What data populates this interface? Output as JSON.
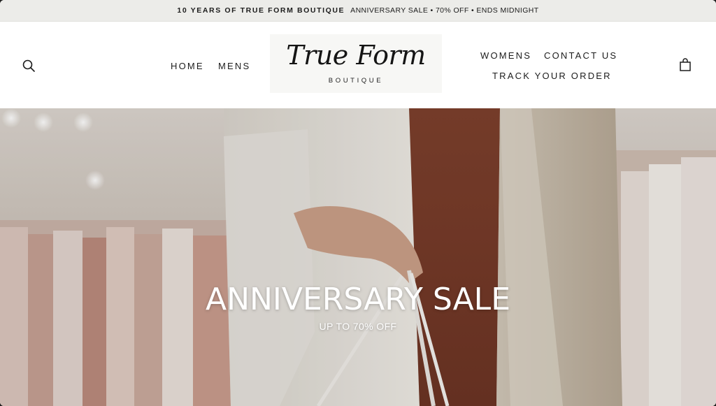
{
  "announcement": {
    "brand": "10 YEARS OF TRUE FORM BOUTIQUE",
    "message": "ANNIVERSARY SALE • 70% OFF • ENDS MIDNIGHT"
  },
  "header": {
    "search_icon": "search-icon",
    "cart_icon": "shopping-bag-icon",
    "nav_left": [
      "HOME",
      "MENS"
    ],
    "nav_right": [
      "WOMENS",
      "CONTACT US",
      "TRACK YOUR ORDER"
    ],
    "logo": {
      "script": "True Form",
      "sub": "BOUTIQUE"
    }
  },
  "hero": {
    "title": "ANNIVERSARY SALE",
    "subtitle": "UP TO 70% OFF"
  },
  "colors": {
    "announcement_bg": "#ecece9",
    "header_bg": "#ffffff",
    "text": "#1c1c1c",
    "hero_text": "#ffffff"
  }
}
